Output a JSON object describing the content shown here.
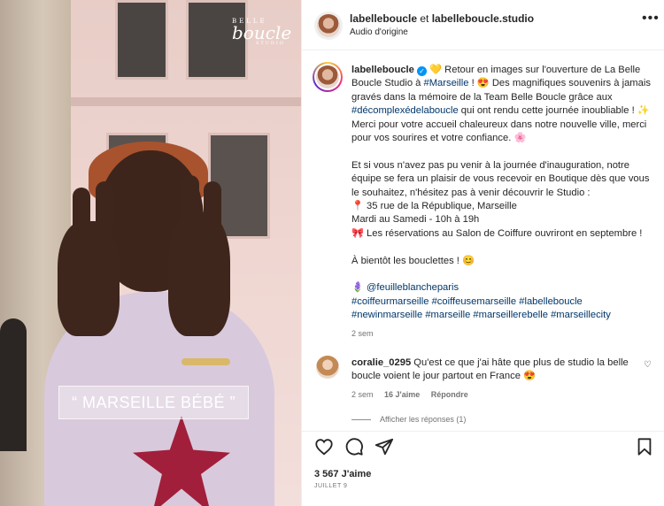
{
  "media": {
    "brand_logo": {
      "top": "BELLE",
      "script": "boucle",
      "bottom": "STUDIO"
    },
    "caption_overlay": "“ MARSEILLE BÉBÉ ”"
  },
  "header": {
    "owner": "labelleboucle",
    "separator": " et ",
    "collaborator": "labelleboucle.studio",
    "audio": "Audio d'origine",
    "more_icon": "more-horizontal-icon"
  },
  "post": {
    "author": "labelleboucle",
    "lines": [
      "💛 Retour en images sur l'ouverture de La Belle Boucle Studio à ",
      "#Marseille",
      " ! 😍 Des magnifiques souvenirs à jamais gravés dans la mémoire de la Team Belle Boucle grâce aux ",
      "#décomplexédelaboucle",
      " qui ont rendu cette journée inoubliable ! ✨ Merci pour votre accueil chaleureux dans notre nouvelle ville, merci pour vos sourires et votre confiance. 🌸"
    ],
    "para2": "Et si vous n'avez pas pu venir à la journée d'inauguration, notre équipe se fera un plaisir de vous recevoir en Boutique dès que vous le souhaitez, n'hésitez pas à venir découvrir le Studio :",
    "address": "📍 35 rue de la République, Marseille",
    "hours": "Mardi au Samedi - 10h à 19h",
    "reservations": "🎀 Les réservations au Salon de Coiffure ouvriront en septembre !",
    "closing": "À bientôt les bouclettes ! 😊",
    "credit_icon": "🪻",
    "credit": "@feuilleblancheparis",
    "hashtags_1": "#coiffeurmarseille #coiffeusemarseille #labelleboucle",
    "hashtags_2": "#newinmarseille #marseille #marseillerebelle #marseillecity",
    "time": "2 sem"
  },
  "comment": {
    "user": "coralie_0295",
    "text": " Qu'est ce que j'ai hâte que plus de studio la belle boucle voient le jour partout en France 😍",
    "time": "2 sem",
    "likes": "16 J'aime",
    "reply": "Répondre",
    "view_replies": "Afficher les réponses (1)"
  },
  "footer": {
    "likes": "3 567 J'aime",
    "date": "JUILLET 9",
    "icons": [
      "heart-icon",
      "comment-icon",
      "share-icon",
      "bookmark-icon"
    ]
  }
}
